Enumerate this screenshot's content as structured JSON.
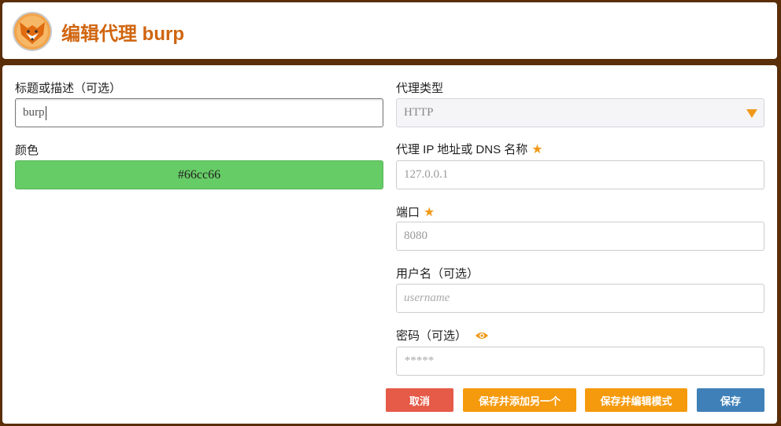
{
  "header": {
    "title": "编辑代理 burp",
    "logo_icon": "foxyproxy-fox-logo-icon"
  },
  "form": {
    "title_field": {
      "label": "标题或描述（可选）",
      "value": "burp"
    },
    "color_field": {
      "label": "颜色",
      "value": "#66cc66"
    },
    "proxy_type": {
      "label": "代理类型",
      "selected": "HTTP"
    },
    "host": {
      "label": "代理 IP 地址或 DNS 名称",
      "placeholder": "127.0.0.1"
    },
    "port": {
      "label": "端口",
      "placeholder": "8080"
    },
    "username": {
      "label": "用户名（可选）",
      "placeholder": "username"
    },
    "password": {
      "label": "密码（可选）",
      "placeholder": "*****"
    }
  },
  "buttons": {
    "cancel": "取消",
    "save_add_another": "保存并添加另一个",
    "save_edit_patterns": "保存并编辑模式",
    "save": "保存"
  },
  "colors": {
    "background": "#5a2e08",
    "title": "#d0650f",
    "accent_orange": "#f59a0c",
    "cancel_red": "#e65a48",
    "save_blue": "#3f80b8",
    "swatch": "#66cc66"
  },
  "icons": {
    "required": "star-icon",
    "password_toggle": "eye-icon",
    "select_arrow": "caret-down-icon"
  }
}
